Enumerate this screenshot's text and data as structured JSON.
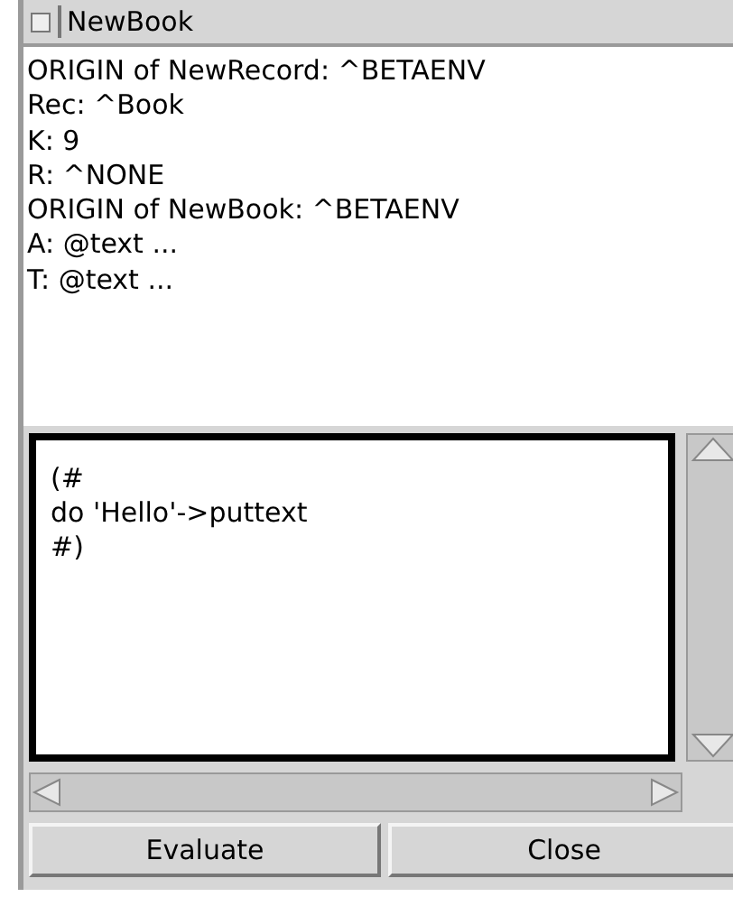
{
  "window": {
    "title": "NewBook"
  },
  "output_lines": [
    "ORIGIN of NewRecord: ^BETAENV",
    "Rec: ^Book",
    "K: 9",
    "R: ^NONE",
    "ORIGIN of NewBook: ^BETAENV",
    "A: @text ...",
    "T: @text ..."
  ],
  "editor": {
    "lines": [
      "(#",
      "do 'Hello'->puttext",
      "#)"
    ]
  },
  "buttons": [
    "Evaluate",
    "Close"
  ]
}
